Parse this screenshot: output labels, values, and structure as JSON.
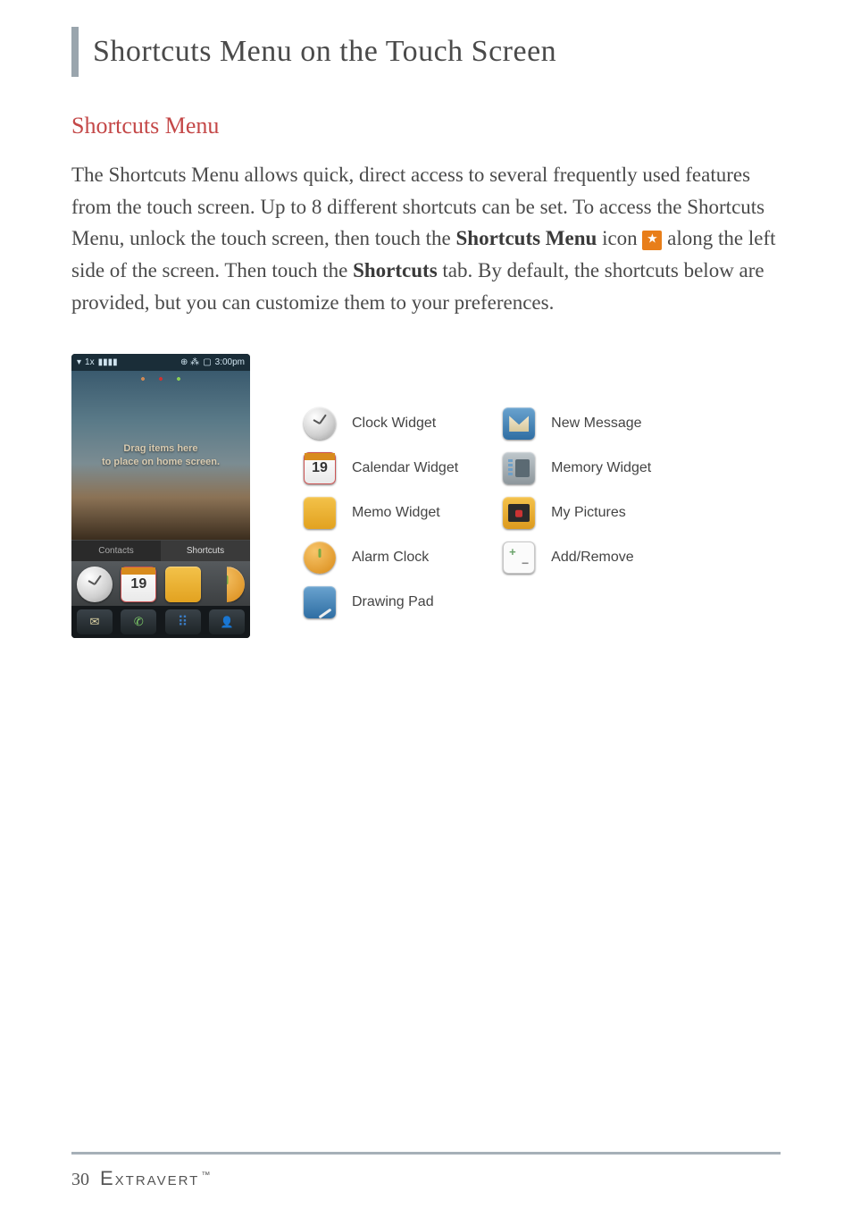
{
  "page": {
    "title": "Shortcuts Menu on the Touch Screen",
    "section_title": "Shortcuts Menu",
    "body": {
      "p1_a": "The Shortcuts Menu allows quick, direct access to several frequently used features from the touch screen. Up to 8 different shortcuts can be set. To access the Shortcuts Menu, unlock the touch screen, then touch the ",
      "p1_bold1": "Shortcuts Menu",
      "p1_b": " icon ",
      "p1_c": " along the left side of the screen. Then touch the ",
      "p1_bold2": "Shortcuts",
      "p1_d": " tab. By default, the shortcuts below are provided, but you can customize them to your preferences."
    }
  },
  "phone": {
    "status": {
      "signal": "1x",
      "icons": "⊕  ⁂",
      "battery": "▮▮▮",
      "time": "3:00pm"
    },
    "hint_line1": "Drag items here",
    "hint_line2": "to place on home screen.",
    "tabs": {
      "contacts": "Contacts",
      "shortcuts": "Shortcuts"
    },
    "calendar_day": "19"
  },
  "legend": {
    "col1": [
      {
        "icon": "clock",
        "label": "Clock Widget"
      },
      {
        "icon": "calendar",
        "label": "Calendar Widget",
        "text": "19"
      },
      {
        "icon": "memo",
        "label": "Memo Widget"
      },
      {
        "icon": "alarm",
        "label": "Alarm Clock"
      },
      {
        "icon": "draw",
        "label": "Drawing Pad"
      }
    ],
    "col2": [
      {
        "icon": "message",
        "label": "New Message"
      },
      {
        "icon": "memory",
        "label": "Memory Widget"
      },
      {
        "icon": "pictures",
        "label": "My Pictures"
      },
      {
        "icon": "addremove",
        "label": "Add/Remove"
      }
    ]
  },
  "footer": {
    "page_number": "30",
    "brand": "Extravert",
    "tm": "™"
  }
}
